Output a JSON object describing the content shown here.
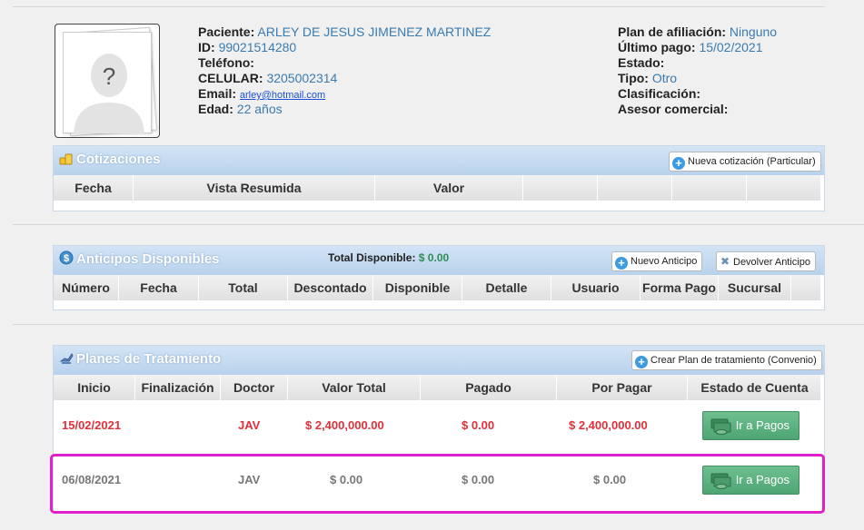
{
  "patient": {
    "name_label": "Paciente:",
    "name": "ARLEY DE JESUS JIMENEZ MARTINEZ",
    "id_label": "ID:",
    "id": "99021514280",
    "phone_label": "Teléfono:",
    "phone": "",
    "cell_label": "CELULAR:",
    "cell": "3205002314",
    "email_label": "Email:",
    "email": "arley@hotmail.com",
    "age_label": "Edad:",
    "age": "22 años",
    "plan_label": "Plan de afiliación:",
    "plan": "Ninguno",
    "last_payment_label": "Último pago:",
    "last_payment": "15/02/2021",
    "status_label": "Estado:",
    "status": "",
    "type_label": "Tipo:",
    "type": "Otro",
    "classification_label": "Clasificación:",
    "classification": "",
    "advisor_label": "Asesor comercial:",
    "advisor": ""
  },
  "quotes": {
    "title": "Cotizaciones",
    "new_button": "Nueva cotización (Particular)",
    "columns": [
      "Fecha",
      "Vista Resumida",
      "Valor",
      "",
      "",
      "",
      ""
    ]
  },
  "advances": {
    "title": "Anticipos Disponibles",
    "total_label": "Total Disponible:",
    "total_value": "$ 0.00",
    "new_button": "Nuevo Anticipo",
    "return_button": "Devolver Anticipo",
    "columns": [
      "Número",
      "Fecha",
      "Total",
      "Descontado",
      "Disponible",
      "Detalle",
      "Usuario",
      "Forma Pago",
      "Sucursal",
      ""
    ]
  },
  "plans": {
    "title": "Planes de Tratamiento",
    "new_button": "Crear Plan de tratamiento (Convenio)",
    "columns": [
      "Inicio",
      "Finalización",
      "Doctor",
      "Valor Total",
      "Pagado",
      "Por Pagar",
      "Estado de Cuenta"
    ],
    "rows": [
      {
        "start": "15/02/2021",
        "end": "",
        "doctor": "JAV",
        "total": "$ 2,400,000.00",
        "paid": "$ 0.00",
        "due": "$ 2,400,000.00",
        "action": "Ir a Pagos"
      },
      {
        "start": "06/08/2021",
        "end": "",
        "doctor": "JAV",
        "total": "$ 0.00",
        "paid": "$ 0.00",
        "due": "$ 0.00",
        "action": "Ir a Pagos"
      }
    ]
  },
  "colors": {
    "accent_link": "#3a7bb0",
    "due_red": "#e0303a",
    "pay_green": "#4ea574",
    "highlight": "#e020c8"
  }
}
